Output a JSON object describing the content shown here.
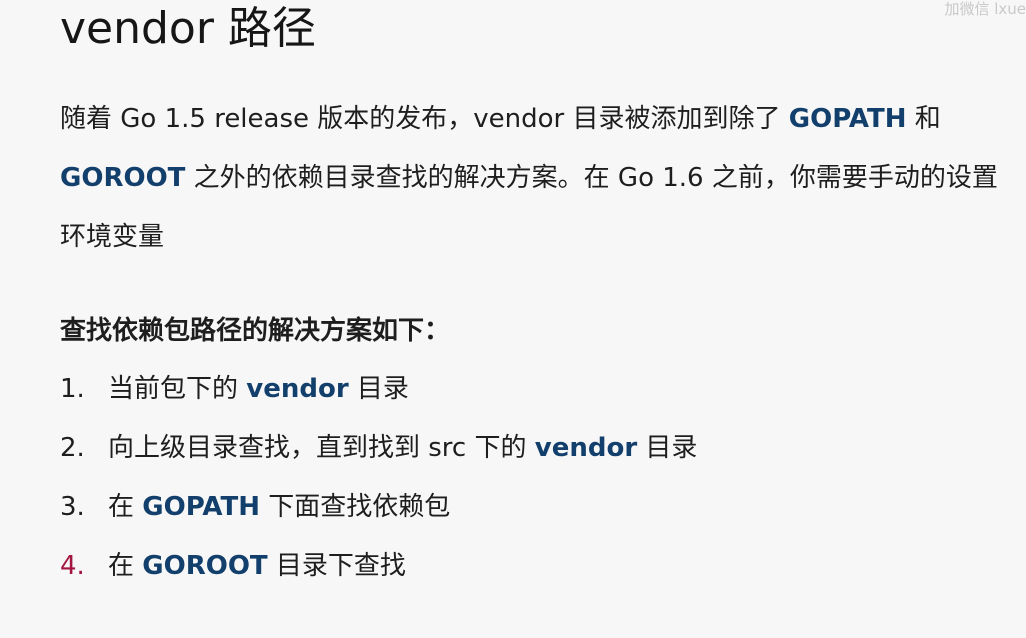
{
  "watermark": "加微信 lxue",
  "title": "vendor 路径",
  "intro": {
    "t1": "随着 Go 1.5 release 版本的发布，vendor 目录被添加到除了 ",
    "k1": "GOPATH",
    "t2": " 和 ",
    "k2": "GOROOT",
    "t3": " 之外的依赖目录查找的解决方案。在 Go 1.6 之前，你需要手动的设置环境变量"
  },
  "subheading": "查找依赖包路径的解决方案如下：",
  "steps": [
    {
      "num": "1.",
      "before": "当前包下的 ",
      "kw": "vendor",
      "after": " 目录"
    },
    {
      "num": "2.",
      "before": "向上级目录查找，直到找到 src 下的 ",
      "kw": "vendor",
      "after": " 目录"
    },
    {
      "num": "3.",
      "before": "在 ",
      "kw": "GOPATH",
      "after": " 下面查找依赖包"
    },
    {
      "num": "4.",
      "before": "在 ",
      "kw": "GOROOT",
      "after": " 目录下查找"
    }
  ],
  "colors": {
    "background": "#f7f7f7",
    "text": "#1e1e1e",
    "keyword": "#123f6b",
    "active_number": "#a3163f"
  }
}
